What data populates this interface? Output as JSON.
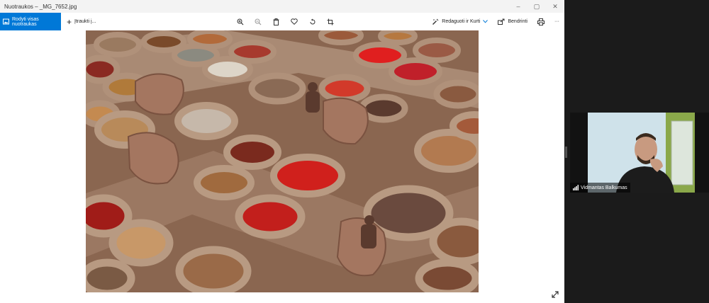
{
  "window": {
    "title": "Nuotraukos – _MG_7652.jpg",
    "controls": {
      "minimize": "–",
      "maximize": "▢",
      "close": "✕"
    }
  },
  "toolbar": {
    "view_all_label": "Rodyti visas nuotraukas",
    "add_label": "Įtraukti į...",
    "tool_icons": [
      "zoom-in-icon",
      "zoom-out-icon",
      "delete-icon",
      "heart-icon",
      "rotate-icon",
      "crop-icon"
    ],
    "edit_label": "Redaguoti ir Kurti",
    "share_label": "Bendrinti",
    "more_label": "···"
  },
  "photo": {
    "description": "Tannery dye vats",
    "colors": {
      "clay": "#a27b62",
      "red": "#c5231a",
      "ochre": "#b98a54",
      "brown": "#7a5643",
      "light": "#c9b8a3"
    }
  },
  "video_call": {
    "participant_name": "Vidmantas Balkumas"
  },
  "colors": {
    "accent": "#0078d7",
    "titlebar_bg": "#f3f3f3",
    "video_bg": "#121212"
  }
}
